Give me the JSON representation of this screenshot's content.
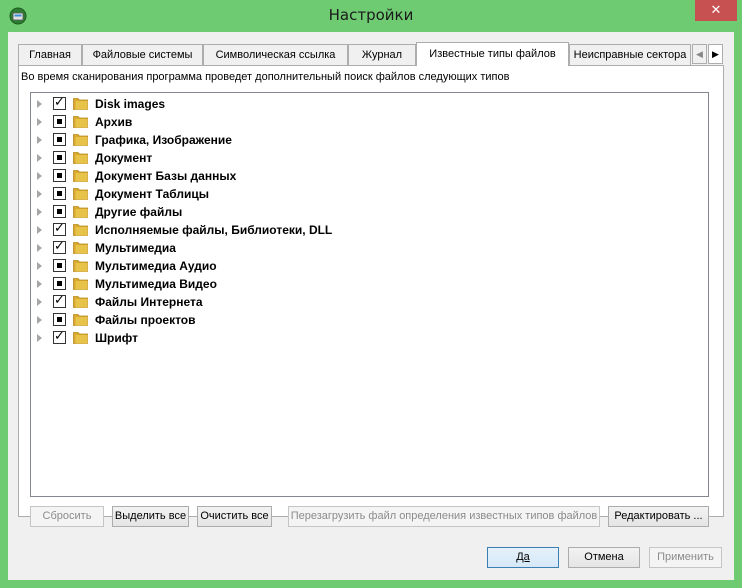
{
  "window": {
    "title": "Настройки",
    "close_glyph": "✕"
  },
  "tabs": [
    {
      "label": "Главная"
    },
    {
      "label": "Файловые системы"
    },
    {
      "label": "Символическая ссылка"
    },
    {
      "label": "Журнал"
    },
    {
      "label": "Известные типы файлов",
      "active": true
    },
    {
      "label": "Неисправные сектора"
    }
  ],
  "tab_scroll": {
    "left": "◀",
    "right": "▶"
  },
  "description": "Во время сканирования программа проведет дополнительный поиск файлов следующих типов",
  "tree_items": [
    {
      "label": "Disk images",
      "state": "checked"
    },
    {
      "label": "Архив",
      "state": "partial"
    },
    {
      "label": "Графика, Изображение",
      "state": "partial"
    },
    {
      "label": "Документ",
      "state": "partial"
    },
    {
      "label": "Документ Базы данных",
      "state": "partial"
    },
    {
      "label": "Документ Таблицы",
      "state": "partial"
    },
    {
      "label": "Другие файлы",
      "state": "partial"
    },
    {
      "label": "Исполняемые файлы, Библиотеки, DLL",
      "state": "checked"
    },
    {
      "label": "Мультимедиа",
      "state": "checked"
    },
    {
      "label": "Мультимедиа Аудио",
      "state": "partial"
    },
    {
      "label": "Мультимедиа Видео",
      "state": "partial"
    },
    {
      "label": "Файлы Интернета",
      "state": "checked"
    },
    {
      "label": "Файлы проектов",
      "state": "partial"
    },
    {
      "label": "Шрифт",
      "state": "checked"
    }
  ],
  "panel_buttons": {
    "reset": "Сбросить",
    "select_all": "Выделить все",
    "clear_all": "Очистить все",
    "reload": "Перезагрузить файл определения известных типов файлов",
    "edit": "Редактировать ..."
  },
  "dialog_buttons": {
    "ok": "Да",
    "cancel": "Отмена",
    "apply": "Применить"
  },
  "colors": {
    "frame": "#6fcb72",
    "folder": "#e8c34a",
    "close": "#c75050"
  },
  "icons": {
    "app": "recovery-app-icon",
    "folder": "folder-icon",
    "expander": "triangle-right-icon"
  }
}
